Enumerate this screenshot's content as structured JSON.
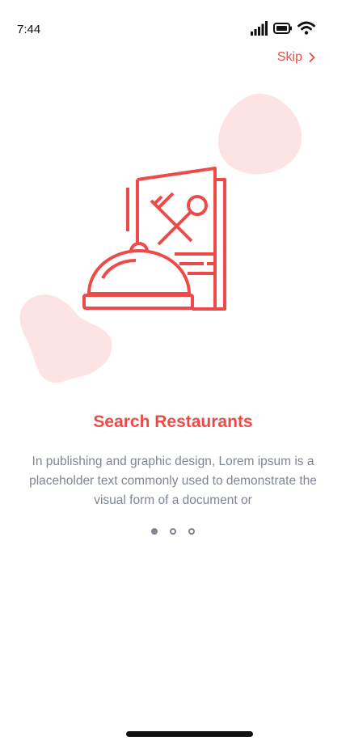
{
  "status_bar": {
    "time": "7:44"
  },
  "header": {
    "skip_label": "Skip",
    "skip_icon": "chevron-right-icon"
  },
  "onboarding": {
    "illustration_icon": "menu-cloche-icon",
    "title": "Search Restaurants",
    "description": "In publishing and graphic design, Lorem ipsum is a placeholder text commonly used to demonstrate the visual form of a document or",
    "page_count": 3,
    "current_page": 1
  },
  "colors": {
    "accent": "#ef4a4a",
    "blob": "#fde3e3",
    "text_muted": "#7f8592"
  }
}
